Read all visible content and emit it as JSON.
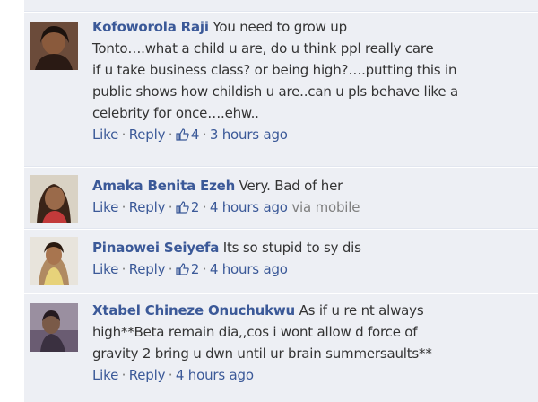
{
  "comments": [
    {
      "author": "Kofoworola Raji",
      "lines": [
        "You need to grow up",
        "Tonto….what a child u are, do u think ppl really care",
        "if u take business class? or being high?….putting this in",
        "public shows how childish u are..can u pls behave like a",
        "celebrity for once….ehw.."
      ],
      "like_label": "Like",
      "reply_label": "Reply",
      "like_count": "4",
      "time": "3 hours ago",
      "via": ""
    },
    {
      "author": "Amaka Benita Ezeh",
      "lines": [
        "Very. Bad of her"
      ],
      "like_label": "Like",
      "reply_label": "Reply",
      "like_count": "2",
      "time": "4 hours ago",
      "via": "via mobile"
    },
    {
      "author": "Pinaowei Seiyefa",
      "lines": [
        "Its so stupid to sy dis"
      ],
      "like_label": "Like",
      "reply_label": "Reply",
      "like_count": "2",
      "time": "4 hours ago",
      "via": ""
    },
    {
      "author": "Xtabel Chineze Onuchukwu",
      "lines": [
        "As if u re nt always",
        "high**Beta remain dia,,cos i wont allow d force of",
        "gravity 2 bring u dwn until ur brain summersaults**"
      ],
      "like_label": "Like",
      "reply_label": "Reply",
      "like_count": "",
      "time": "4 hours ago",
      "via": ""
    }
  ],
  "colors": {
    "link": "#3b5998",
    "background": "#edeff4",
    "divider": "#e2e6ef",
    "meta_text": "#808080"
  },
  "icons": [
    "profile-photo",
    "thumbs-up-icon"
  ]
}
